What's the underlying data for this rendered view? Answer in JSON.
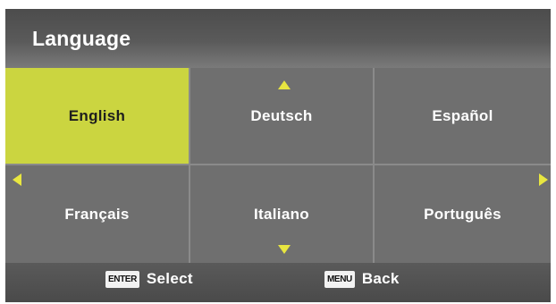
{
  "header": {
    "title": "Language"
  },
  "languages": [
    {
      "label": "English",
      "selected": true
    },
    {
      "label": "Deutsch",
      "selected": false
    },
    {
      "label": "Español",
      "selected": false
    },
    {
      "label": "Français",
      "selected": false
    },
    {
      "label": "Italiano",
      "selected": false
    },
    {
      "label": "Português",
      "selected": false
    }
  ],
  "footer": {
    "select": {
      "key": "ENTER",
      "label": "Select"
    },
    "back": {
      "key": "MENU",
      "label": "Back"
    }
  },
  "colors": {
    "selected": "#cbd540",
    "arrow": "#e8e640",
    "cell": "#6f6f6f"
  },
  "icons": [
    "arrow-up-icon",
    "arrow-down-icon",
    "arrow-left-icon",
    "arrow-right-icon"
  ]
}
